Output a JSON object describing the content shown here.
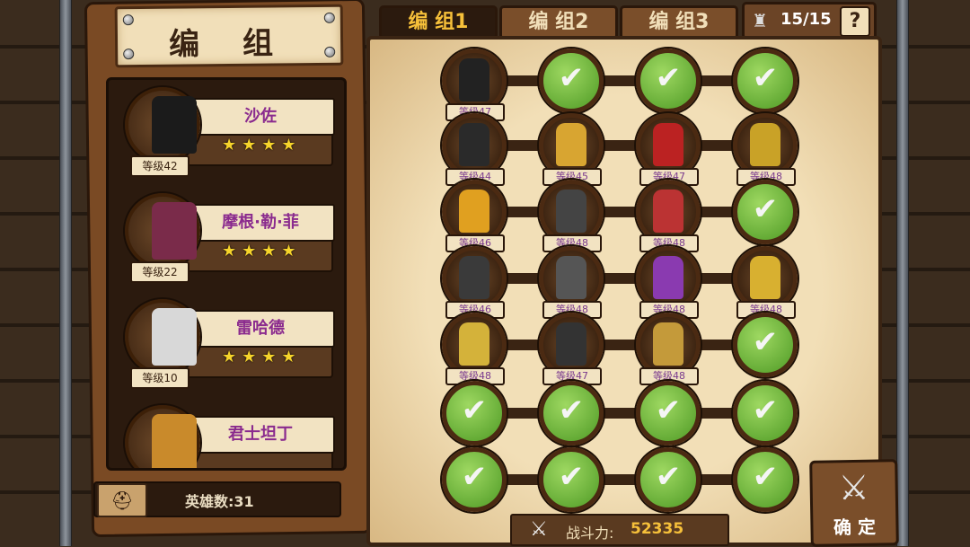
{
  "title": "编 组",
  "tabs": [
    {
      "label": "编 组1",
      "active": true
    },
    {
      "label": "编 组2",
      "active": false
    },
    {
      "label": "编 组3",
      "active": false
    }
  ],
  "unit_counter": {
    "text": "15/15",
    "icon": "soldiers-icon"
  },
  "help_label": "?",
  "heroes": [
    {
      "name": "沙佐",
      "level": "等级42",
      "stars": "★★★★",
      "color": "#1b1b1b"
    },
    {
      "name": "摩根·勒·菲",
      "level": "等级22",
      "stars": "★★★★",
      "color": "#7a2b4a"
    },
    {
      "name": "雷哈德",
      "level": "等级10",
      "stars": "★★★★",
      "color": "#d8d8d8"
    },
    {
      "name": "君士坦丁",
      "level": "",
      "stars": "",
      "color": "#c98a2b"
    }
  ],
  "hero_count": "英雄数:31",
  "grid": [
    [
      {
        "level": "等级47",
        "color": "#222"
      },
      null,
      null,
      null
    ],
    [
      {
        "level": "等级44",
        "color": "#2a2a2a"
      },
      {
        "level": "等级45",
        "color": "#d8a531"
      },
      {
        "level": "等级47",
        "color": "#b22"
      },
      {
        "level": "等级48",
        "color": "#c9a227"
      }
    ],
    [
      {
        "level": "等级46",
        "color": "#e0a020"
      },
      {
        "level": "等级48",
        "color": "#444"
      },
      {
        "level": "等级48",
        "color": "#b33"
      },
      null
    ],
    [
      {
        "level": "等级46",
        "color": "#3a3a3a"
      },
      {
        "level": "等级48",
        "color": "#555"
      },
      {
        "level": "等级48",
        "color": "#8a3ab0"
      },
      {
        "level": "等级48",
        "color": "#d8b030"
      }
    ],
    [
      {
        "level": "等级48",
        "color": "#d4b23a"
      },
      {
        "level": "等级47",
        "color": "#333"
      },
      {
        "level": "等级48",
        "color": "#c49a3a"
      },
      null
    ],
    [
      null,
      null,
      null,
      null
    ],
    [
      null,
      null,
      null,
      null
    ]
  ],
  "power": {
    "label": "战斗力:",
    "value": "52335"
  },
  "confirm_label": "确 定",
  "icons": {
    "check": "✔",
    "swords": "⚔"
  }
}
